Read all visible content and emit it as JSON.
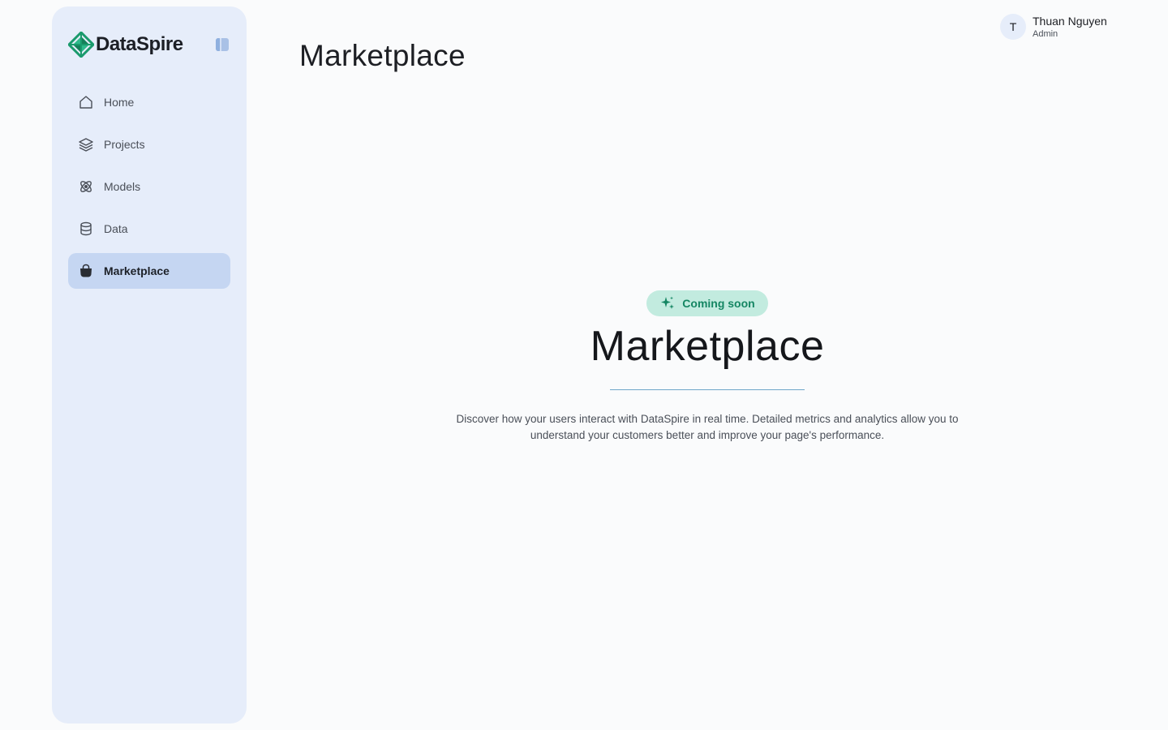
{
  "brand": {
    "name": "DataSpire",
    "accent": "#1a9a6c"
  },
  "sidebar": {
    "items": [
      {
        "label": "Home",
        "icon": "home-icon",
        "active": false
      },
      {
        "label": "Projects",
        "icon": "layers-icon",
        "active": false
      },
      {
        "label": "Models",
        "icon": "atom-icon",
        "active": false
      },
      {
        "label": "Data",
        "icon": "database-icon",
        "active": false
      },
      {
        "label": "Marketplace",
        "icon": "shopping-bag-icon",
        "active": true
      }
    ]
  },
  "header": {
    "title": "Marketplace"
  },
  "user": {
    "initial": "T",
    "name": "Thuan Nguyen",
    "role": "Admin"
  },
  "hero": {
    "badge": "Coming soon",
    "title": "Marketplace",
    "description": "Discover how your users interact with DataSpire in real time. Detailed metrics and analytics allow you to understand your customers better and improve your page's performance."
  },
  "colors": {
    "sidebar_bg": "#e6edfa",
    "active_item_bg": "#c5d6f2",
    "badge_bg": "#c2ebdf",
    "badge_text": "#158663"
  }
}
